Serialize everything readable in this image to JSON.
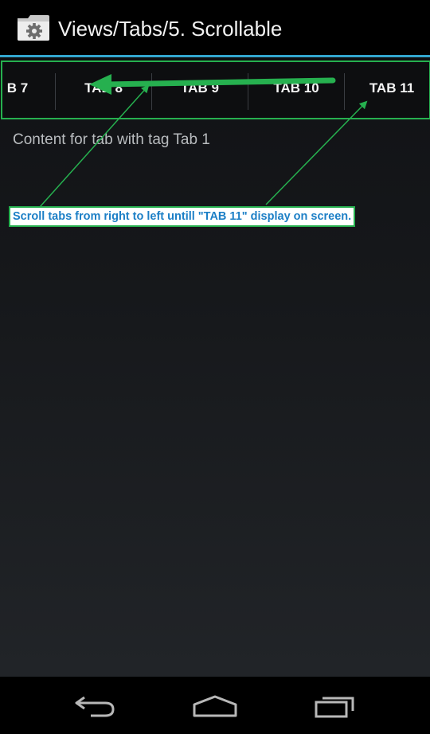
{
  "action_bar": {
    "title": "Views/Tabs/5. Scrollable",
    "icon": "settings-folder-icon"
  },
  "tabs": [
    {
      "label": "B 7"
    },
    {
      "label": "TAB 8"
    },
    {
      "label": "TAB 9"
    },
    {
      "label": "TAB 10"
    },
    {
      "label": "TAB 11"
    }
  ],
  "content": {
    "text": "Content for tab with tag Tab 1"
  },
  "annotation": {
    "note": "Scroll tabs from right to left untill \"TAB 11\" display on screen.",
    "color": "#26b04f",
    "text_color": "#1c7fc6"
  },
  "nav_bar": {
    "back": "back-icon",
    "home": "home-icon",
    "recents": "recent-apps-icon"
  },
  "colors": {
    "accent": "#33a6cf",
    "action_bar_bg": "#000000"
  }
}
